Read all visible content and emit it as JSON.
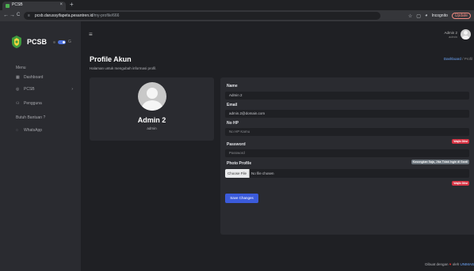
{
  "browser": {
    "tab_title": "PCSB",
    "tab_close": "×",
    "new_tab": "+",
    "back": "←",
    "forward": "→",
    "reload": "C",
    "url_host": "pcsb.darussyifapeta.pesantren.id",
    "url_path": "/my-profile/666",
    "incognito_label": "Incognito",
    "update_label": "Update"
  },
  "sidebar": {
    "brand": "PCSB",
    "brand_extra": "G",
    "menu_title": "Menu",
    "items": [
      {
        "icon": "▦",
        "label": "Dashboard",
        "chevron": ""
      },
      {
        "icon": "◎",
        "label": "PCSB",
        "chevron": "›"
      },
      {
        "icon": "⚇",
        "label": "Pengguna",
        "chevron": ""
      },
      {
        "icon": "",
        "label": "Butuh Bantuan ?",
        "chevron": ""
      },
      {
        "icon": "◌",
        "label": "WhatsApp",
        "chevron": ""
      }
    ]
  },
  "topbar": {
    "user_name": "Admin 2",
    "user_role": "admin"
  },
  "header": {
    "title": "Profile Akun",
    "subtitle": "Halaman untuk mengubah informasi profil.",
    "breadcrumb_link": "Dashboard",
    "breadcrumb_sep": "/",
    "breadcrumb_current": "Profil"
  },
  "profile_card": {
    "name": "Admin 2",
    "role": "admin"
  },
  "form": {
    "name_label": "Name",
    "name_value": "Admin 2",
    "email_label": "Email",
    "email_value": "admin.2@domain.com",
    "phone_label": "No HP",
    "phone_placeholder": "No HP Kamu",
    "password_label": "Password",
    "password_placeholder": "Password",
    "password_badge": "Wajib Diisi",
    "photo_label": "Photo Profile",
    "photo_hint": "Kosongkan Saja, Jika Tidak Ingin di Ganti",
    "choose_file": "Choose File",
    "no_file": "No file chosen",
    "photo_badge": "Wajib Diisi",
    "save_label": "Save Changes"
  },
  "footer": {
    "prefix": "Dibuat dengan",
    "heart": "♥",
    "by": "oleh",
    "brand": "UNIMAS"
  },
  "colors": {
    "accent": "#3b5bdb",
    "danger": "#d63343",
    "link": "#6ea8fe"
  }
}
